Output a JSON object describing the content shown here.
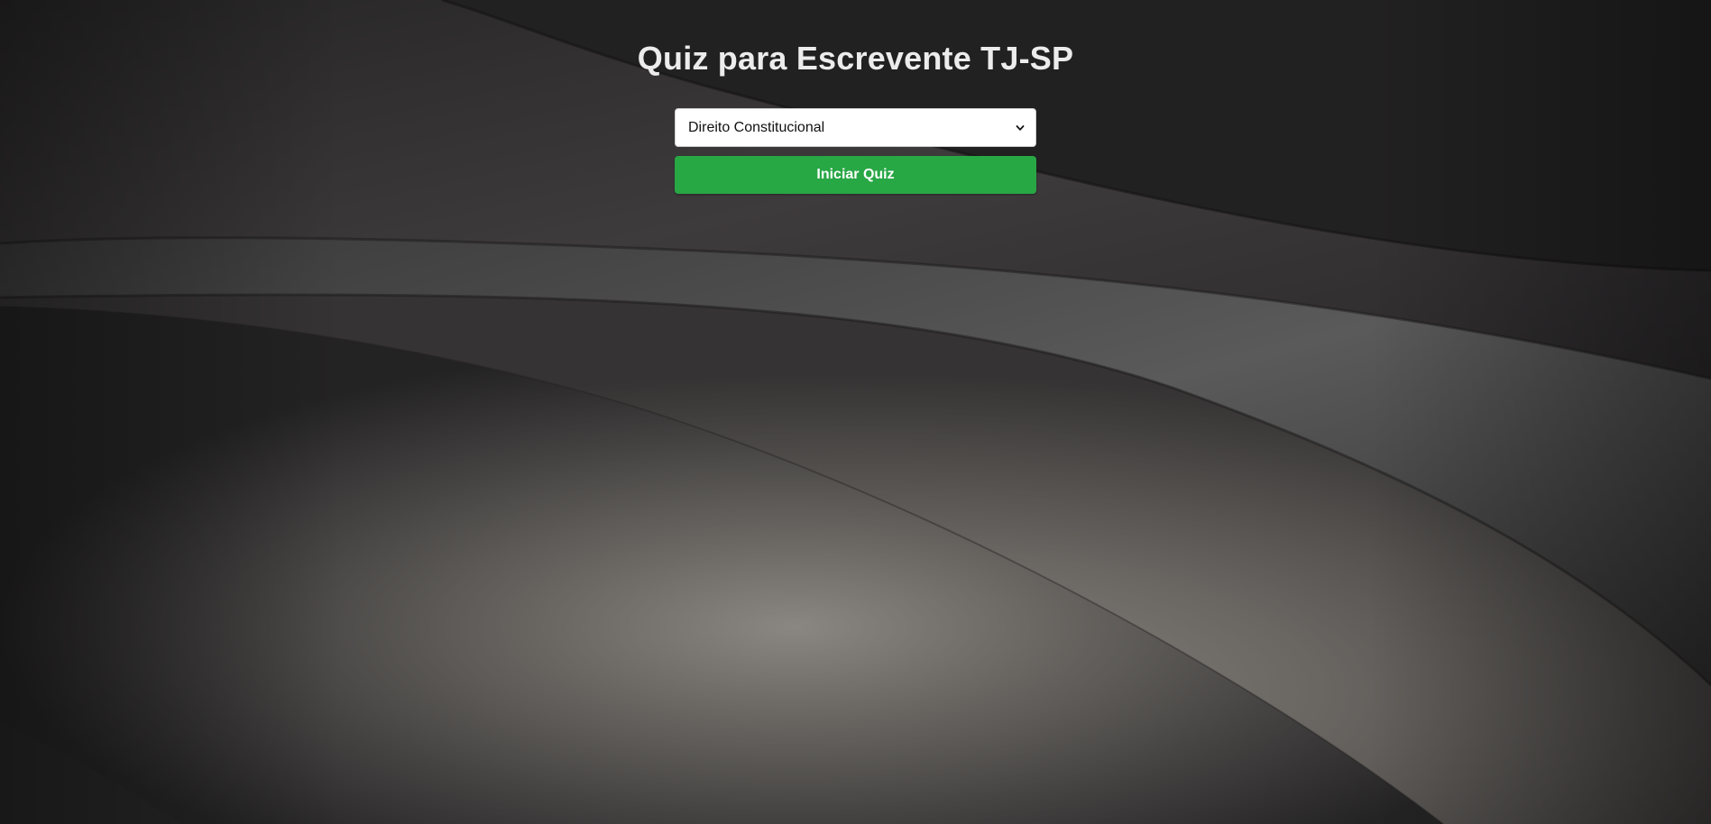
{
  "page": {
    "title": "Quiz para Escrevente TJ-SP"
  },
  "quiz_form": {
    "topic_selected": "Direito Constitucional",
    "start_label": "Iniciar Quiz",
    "start_color": "#28a745"
  },
  "icons": {
    "select_arrow": "chevron-down-icon"
  }
}
